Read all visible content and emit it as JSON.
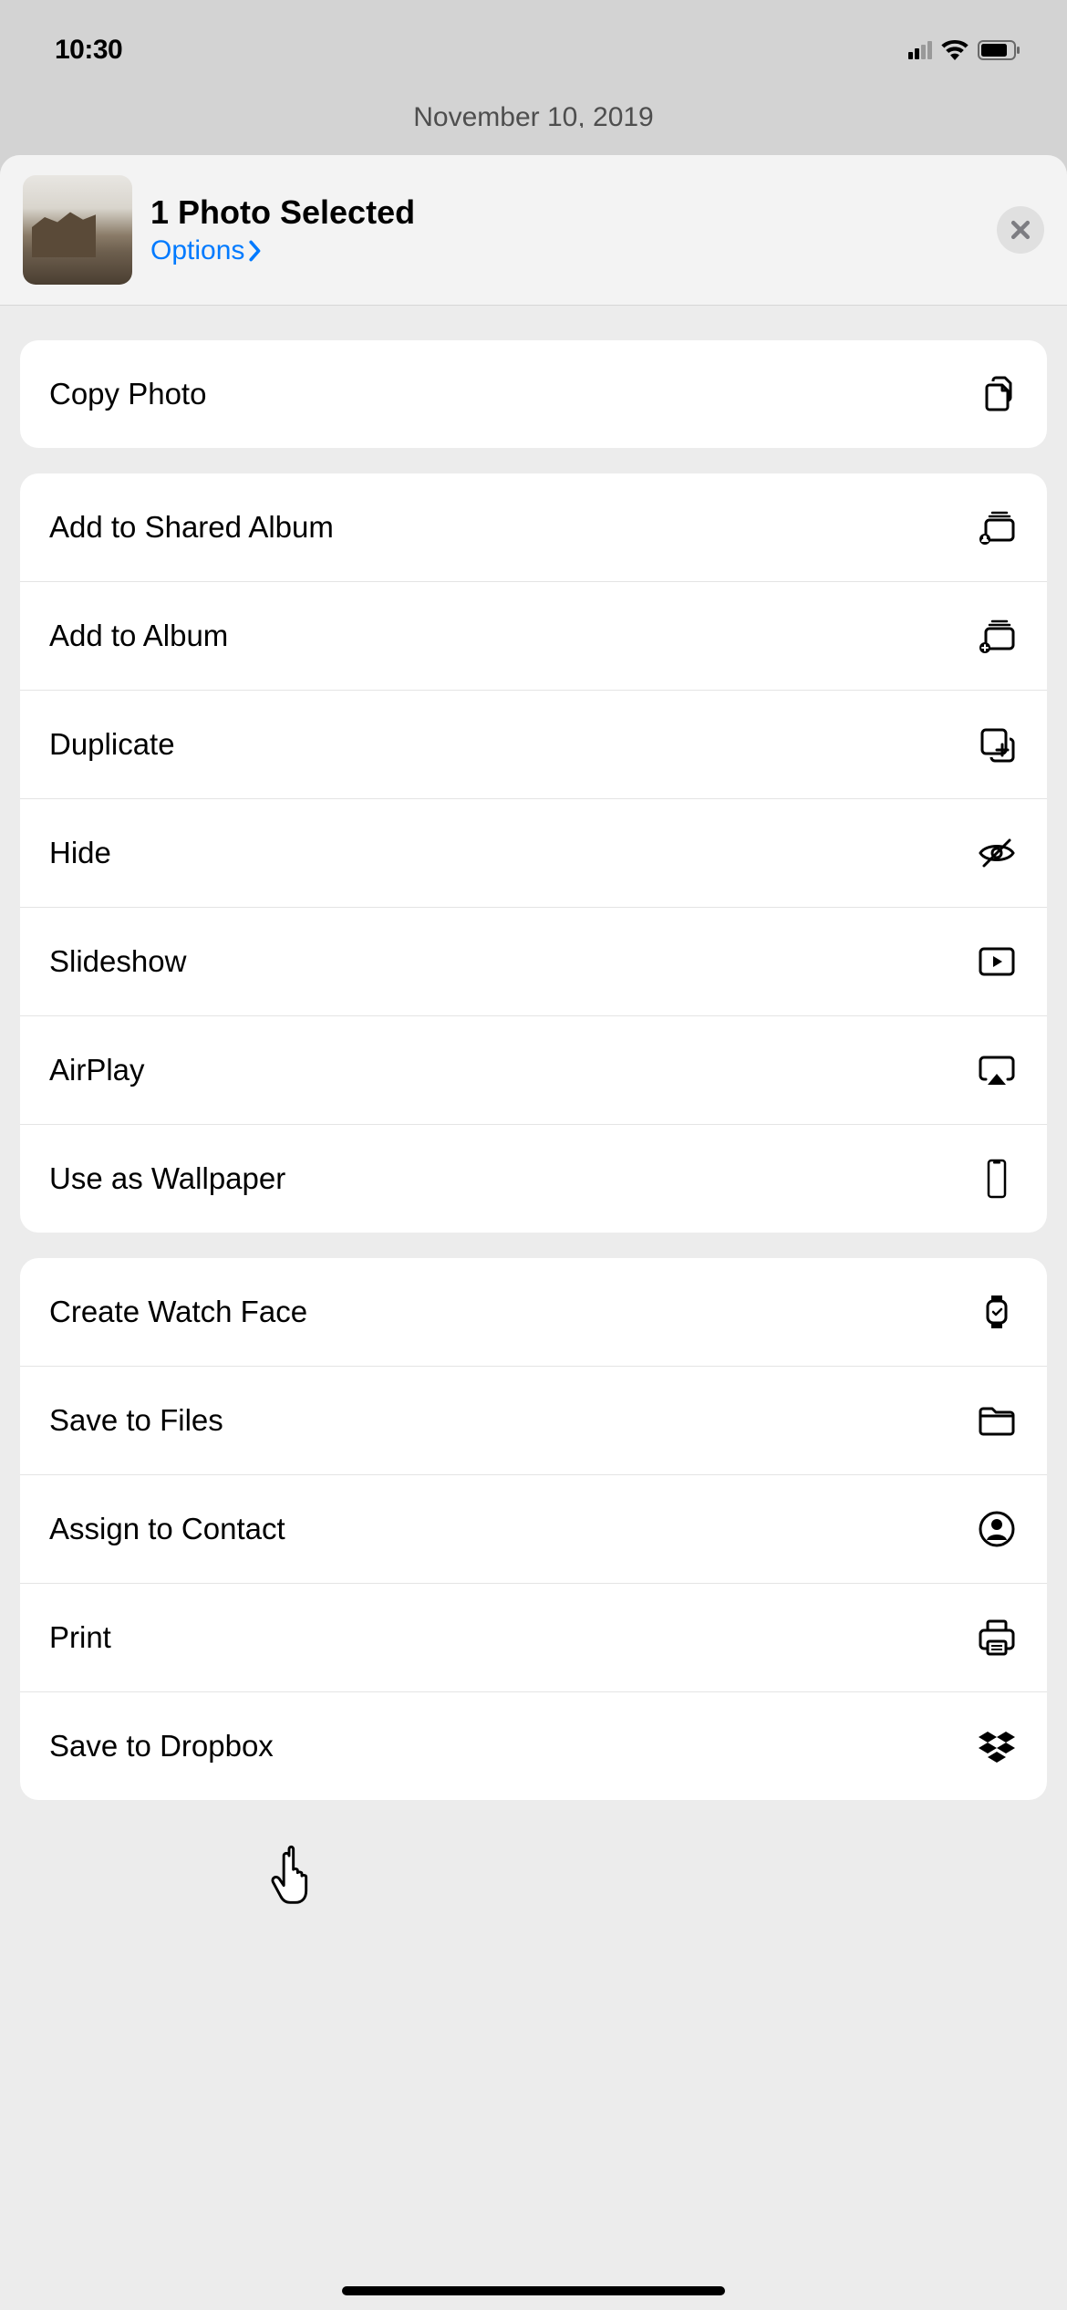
{
  "statusBar": {
    "time": "10:30"
  },
  "background": {
    "peekText": "November 10, 2019"
  },
  "sheet": {
    "title": "1 Photo Selected",
    "optionsLabel": "Options"
  },
  "groups": [
    {
      "actions": [
        {
          "id": "copy-photo",
          "label": "Copy Photo",
          "icon": "copy"
        }
      ]
    },
    {
      "actions": [
        {
          "id": "add-shared-album",
          "label": "Add to Shared Album",
          "icon": "shared-album"
        },
        {
          "id": "add-album",
          "label": "Add to Album",
          "icon": "add-album"
        },
        {
          "id": "duplicate",
          "label": "Duplicate",
          "icon": "duplicate"
        },
        {
          "id": "hide",
          "label": "Hide",
          "icon": "hide"
        },
        {
          "id": "slideshow",
          "label": "Slideshow",
          "icon": "play"
        },
        {
          "id": "airplay",
          "label": "AirPlay",
          "icon": "airplay"
        },
        {
          "id": "wallpaper",
          "label": "Use as Wallpaper",
          "icon": "phone"
        }
      ]
    },
    {
      "actions": [
        {
          "id": "watch-face",
          "label": "Create Watch Face",
          "icon": "watch"
        },
        {
          "id": "save-files",
          "label": "Save to Files",
          "icon": "folder"
        },
        {
          "id": "assign-contact",
          "label": "Assign to Contact",
          "icon": "contact"
        },
        {
          "id": "print",
          "label": "Print",
          "icon": "printer"
        },
        {
          "id": "save-dropbox",
          "label": "Save to Dropbox",
          "icon": "dropbox"
        }
      ]
    }
  ]
}
